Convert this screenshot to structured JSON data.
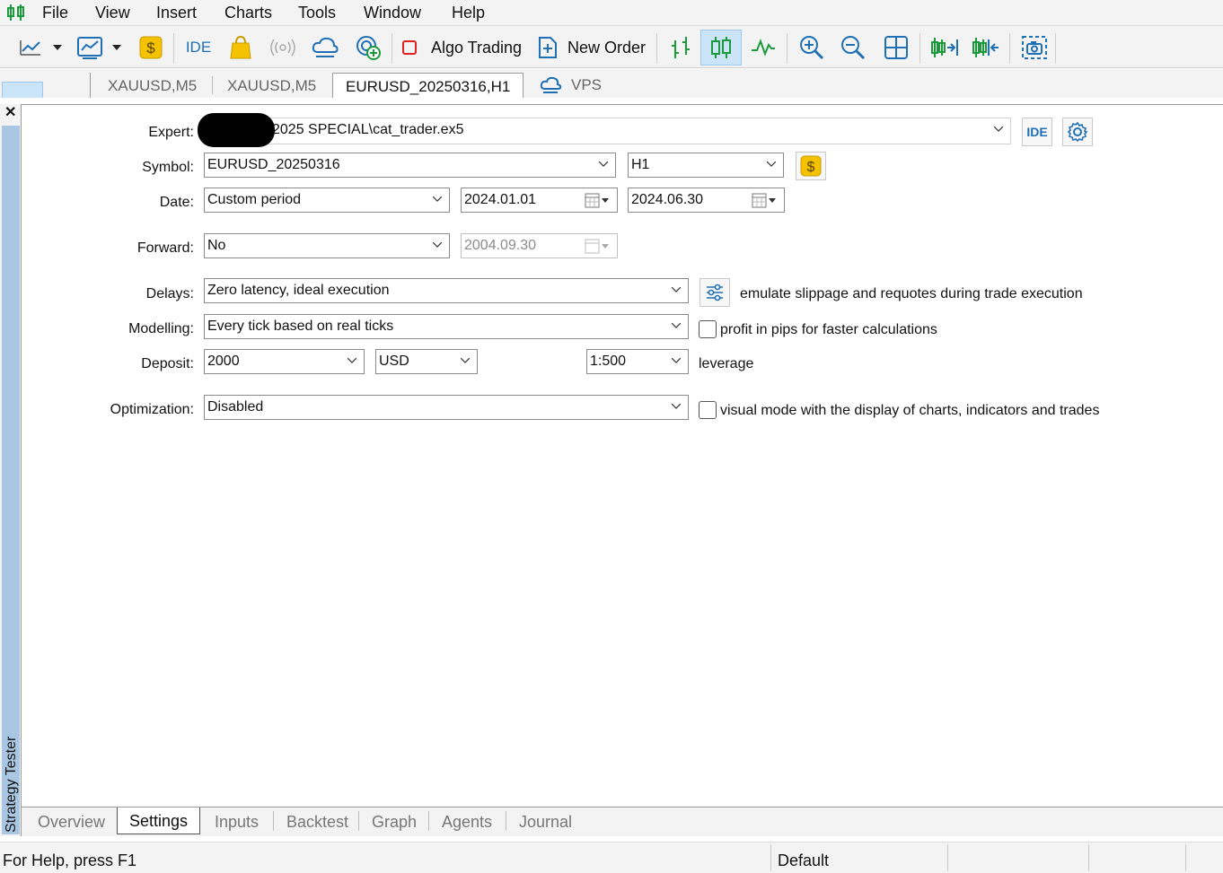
{
  "menu": {
    "items": [
      "File",
      "View",
      "Insert",
      "Charts",
      "Tools",
      "Window",
      "Help"
    ]
  },
  "toolbar": {
    "ide_label": "IDE",
    "algo_trading_label": "Algo Trading",
    "new_order_label": "New Order",
    "accent_green": "#1a9a3a",
    "accent_blue": "#1f6fb5",
    "accent_gold": "#f5c200"
  },
  "chart_tabs": [
    "XAUUSD,M5",
    "XAUUSD,M5",
    "EURUSD_20250316,H1",
    "VPS"
  ],
  "side_panel": {
    "title": "Strategy Tester"
  },
  "settings": {
    "expert": {
      "label": "Expert:",
      "value": "2025 SPECIAL\\cat_trader.ex5"
    },
    "ide_button": "IDE",
    "symbol": {
      "label": "Symbol:",
      "value": "EURUSD_20250316",
      "timeframe": "H1"
    },
    "date": {
      "label": "Date:",
      "period": "Custom period",
      "from": "2024.01.01",
      "to": "2024.06.30"
    },
    "forward": {
      "label": "Forward:",
      "value": "No",
      "date": "2004.09.30"
    },
    "delays": {
      "label": "Delays:",
      "value": "Zero latency, ideal execution",
      "note": "emulate slippage and requotes during trade execution"
    },
    "modelling": {
      "label": "Modelling:",
      "value": "Every tick based on real ticks",
      "checkbox_label": "profit in pips for faster calculations",
      "checked": false
    },
    "deposit": {
      "label": "Deposit:",
      "amount": "2000",
      "currency": "USD",
      "leverage": "1:500",
      "leverage_label": "leverage"
    },
    "optimization": {
      "label": "Optimization:",
      "value": "Disabled",
      "checkbox_label": "visual mode with the display of charts, indicators and trades",
      "checked": false
    }
  },
  "bottom_tabs": [
    "Overview",
    "Settings",
    "Inputs",
    "Backtest",
    "Graph",
    "Agents",
    "Journal"
  ],
  "status": {
    "help": "For Help, press F1",
    "profile": "Default"
  }
}
